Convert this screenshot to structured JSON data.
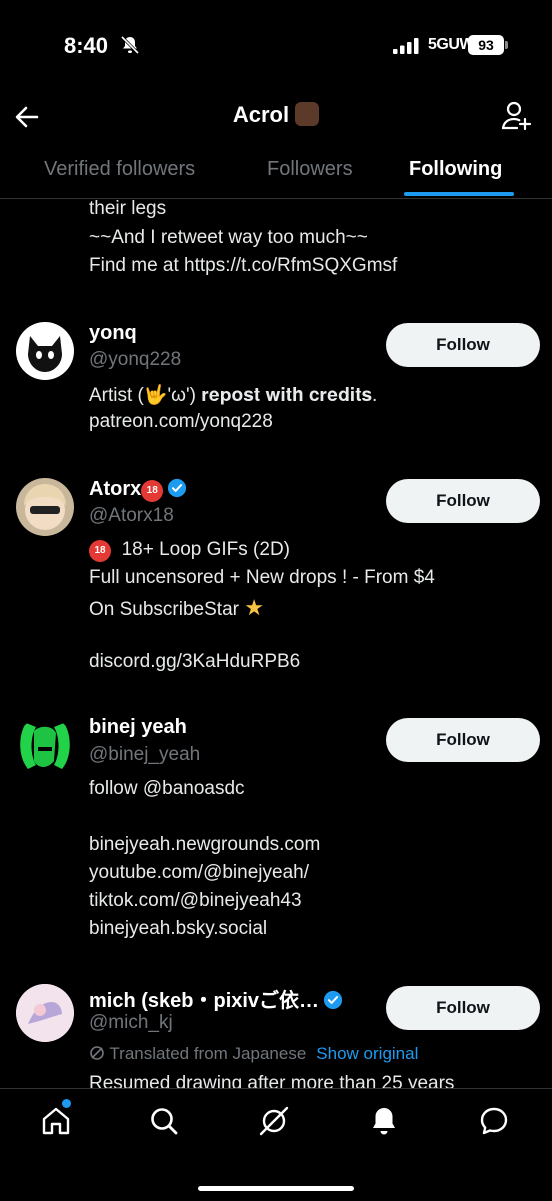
{
  "status": {
    "time": "8:40",
    "network": "5GUW",
    "battery": "93"
  },
  "header": {
    "title": "Acrol"
  },
  "tabs": [
    "Verified followers",
    "Followers",
    "Following"
  ],
  "partial_bio": [
    "their legs",
    "~~And I retweet way too much~~",
    "Find me at https://t.co/RfmSQXGmsf"
  ],
  "users": [
    {
      "name": "yonq",
      "handle": "@yonq228",
      "bio": [
        "Artist (🤟'ω') 𝐫𝐞𝐩𝐨𝐬𝐭 𝐰𝐢𝐭𝐡 𝐜𝐫𝐞𝐝𝐢𝐭𝐬.",
        "patreon.com/yonq228"
      ],
      "button": "Follow"
    },
    {
      "name": "Atorx",
      "badge": "18",
      "handle": "@Atorx18",
      "bio_line1": "18+ Loop GIFs (2D)",
      "bio": [
        "Full uncensored + New drops ! - From $4",
        "On SubscribeStar",
        "",
        "discord.gg/3KaHduRPB6"
      ],
      "button": "Follow"
    },
    {
      "name": "binej yeah",
      "handle": "@binej_yeah",
      "bio": [
        "follow @banoasdc",
        "",
        "binejyeah.newgrounds.com",
        "youtube.com/@binejyeah/",
        "tiktok.com/@binejyeah43",
        "binejyeah.bsky.social"
      ],
      "button": "Follow"
    },
    {
      "name": "mich (skeb・pixivご依…",
      "handle": "@mich_kj",
      "translated": "Translated from Japanese",
      "show_original": "Show original",
      "bio": [
        "Resumed drawing after more than 25 years"
      ],
      "button": "Follow"
    }
  ],
  "nav": [
    "home-icon",
    "search-icon",
    "grok-icon",
    "notifications-icon",
    "messages-icon"
  ],
  "colors": {
    "accent": "#1d9bf0",
    "background": "#000000",
    "muted": "#71767b"
  }
}
